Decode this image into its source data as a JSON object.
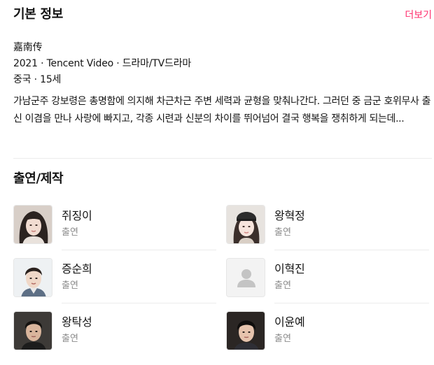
{
  "basic_info": {
    "title": "기본 정보",
    "more_label": "더보기",
    "original_title": "嘉南传",
    "meta": "2021 · Tencent Video · 드라마/TV드라마",
    "country_rating": "중국 · 15세",
    "synopsis": "가남군주 강보령은 총명함에 의지해 차근차근 주변 세력과 균형을 맞춰나간다. 그러던 중 금군 호위무사 출신 이겸을 만나 사랑에 빠지고, 각종 시련과 신분의 차이를 뛰어넘어 결국 행복을 쟁취하게 되는데..."
  },
  "cast": {
    "title": "출연/제작",
    "people": [
      {
        "name": "쥐징이",
        "role": "출연"
      },
      {
        "name": "왕혁정",
        "role": "출연"
      },
      {
        "name": "증순희",
        "role": "출연"
      },
      {
        "name": "이혁진",
        "role": "출연"
      },
      {
        "name": "왕탁성",
        "role": "출연"
      },
      {
        "name": "이윤예",
        "role": "출연"
      }
    ]
  },
  "colors": {
    "accent": "#ff2f6e",
    "text": "#141414",
    "subtext": "#8c8c8c",
    "divider": "#ececec",
    "placeholder_bg": "#f3f3f3",
    "placeholder_icon": "#c4c4c4"
  }
}
